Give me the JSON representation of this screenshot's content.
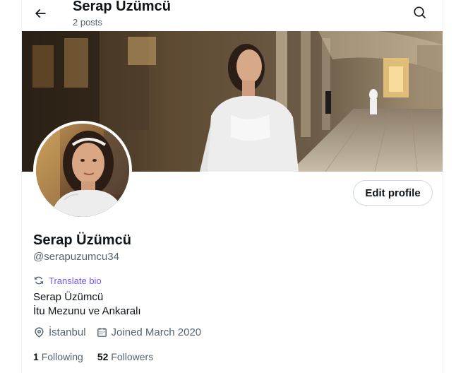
{
  "header": {
    "name": "Serap Üzümcü",
    "posts": "2 posts"
  },
  "icons": {
    "back": "arrow-left-icon",
    "search": "search-icon",
    "translate": "translate-icon",
    "location": "location-pin-icon",
    "calendar": "calendar-icon"
  },
  "profile": {
    "edit_label": "Edit profile",
    "display_name": "Serap Üzümcü",
    "handle": "@serapuzumcu34",
    "translate_label": "Translate bio",
    "bio_lines": [
      "Serap Üzümcü",
      "İtu Mezunu ve Ankaralı"
    ],
    "location": "İstanbul",
    "joined": "Joined March 2020",
    "following_count": "1",
    "following_label": "Following",
    "followers_count": "52",
    "followers_label": "Followers"
  },
  "colors": {
    "accent_translate": "#7856ff",
    "secondary_text": "#536471",
    "primary_text": "#0f1419"
  }
}
